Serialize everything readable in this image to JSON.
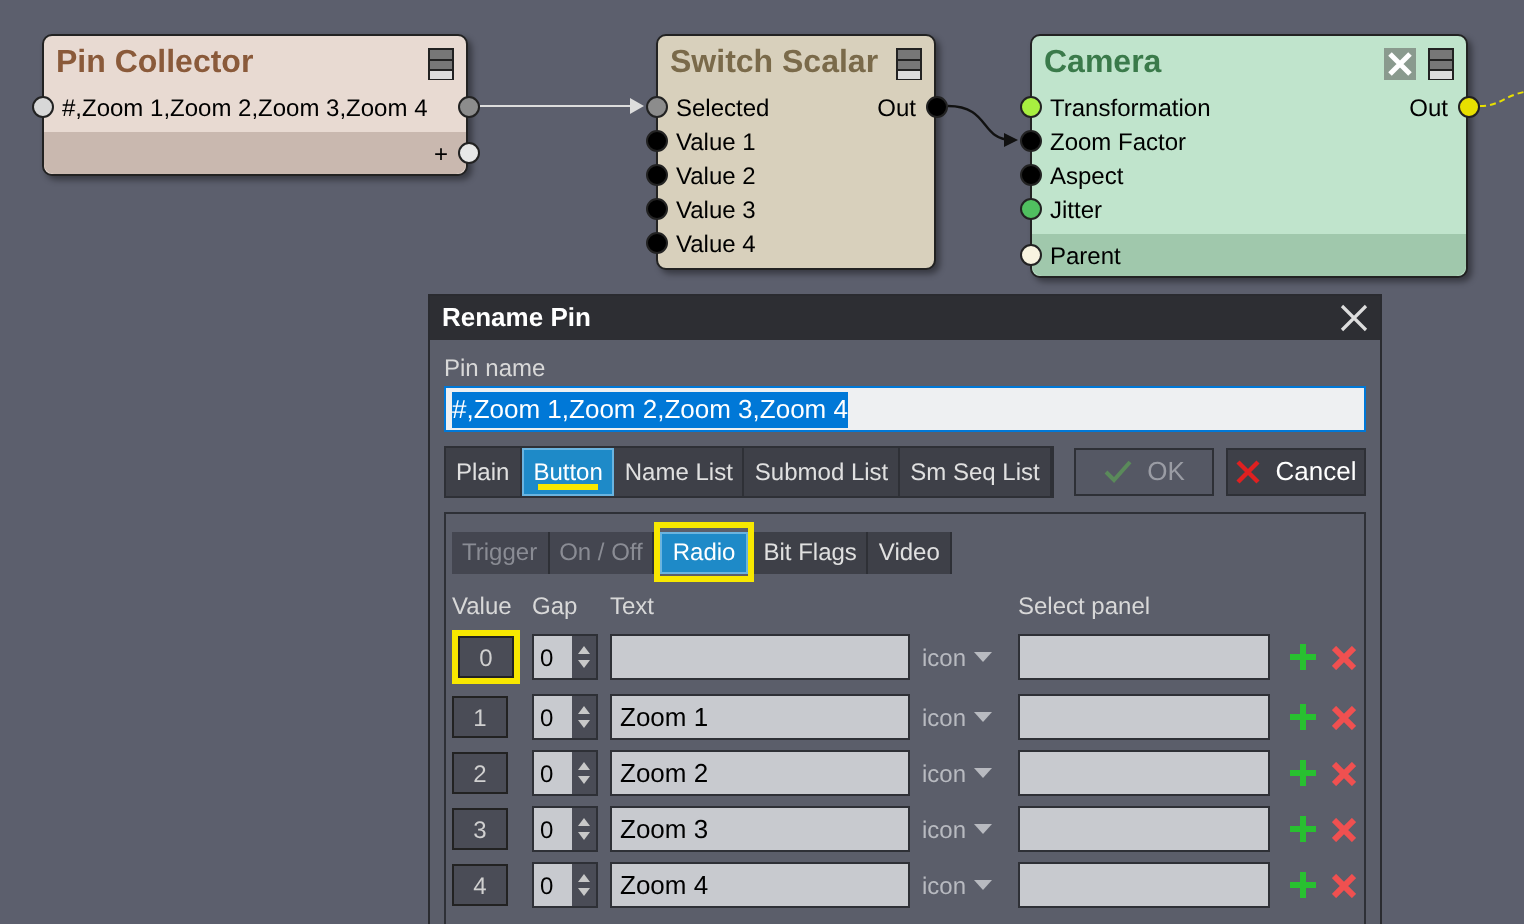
{
  "nodes": [
    {
      "title": "Pin Collector",
      "color": "#e8dad2",
      "closable": false,
      "rows": [
        {
          "in": {
            "label": "#,Zoom 1,Zoom 2,Zoom 3,Zoom 4",
            "color": "#d8d8d8"
          },
          "out": {
            "color": "#8c8c8c"
          }
        }
      ],
      "footer_rows": [
        {
          "out": {
            "label": "+",
            "color": "#e8e8e8"
          }
        }
      ]
    },
    {
      "title": "Switch Scalar",
      "color": "#d8d0bc",
      "closable": false,
      "rows": [
        {
          "in": {
            "label": "Selected",
            "color": "#8c8c8c"
          },
          "out": {
            "label": "Out",
            "color": "#000000"
          }
        },
        {
          "in": {
            "label": "Value 1",
            "color": "#000000"
          }
        },
        {
          "in": {
            "label": "Value 2",
            "color": "#000000"
          }
        },
        {
          "in": {
            "label": "Value 3",
            "color": "#000000"
          }
        },
        {
          "in": {
            "label": "Value 4",
            "color": "#000000"
          }
        }
      ]
    },
    {
      "title": "Camera",
      "color": "#c0e4cc",
      "closable": true,
      "rows": [
        {
          "in": {
            "label": "Transformation",
            "color": "#a8f040"
          },
          "out": {
            "label": "Out",
            "color": "#e8e000"
          }
        },
        {
          "in": {
            "label": "Zoom Factor",
            "color": "#000000"
          }
        },
        {
          "in": {
            "label": "Aspect",
            "color": "#000000"
          }
        },
        {
          "in": {
            "label": "Jitter",
            "color": "#50c060"
          }
        }
      ],
      "footer_rows": [
        {
          "in": {
            "label": "Parent",
            "color": "#f8f4e0"
          }
        }
      ]
    }
  ],
  "dialog": {
    "title": "Rename Pin",
    "field_label": "Pin name",
    "field_value": "#,Zoom 1,Zoom 2,Zoom 3,Zoom 4",
    "tabs": [
      {
        "label": "Plain",
        "selected": false,
        "underlined": false
      },
      {
        "label": "Button",
        "selected": true,
        "underlined": true
      },
      {
        "label": "Name List",
        "selected": false,
        "underlined": false
      },
      {
        "label": "Submod List",
        "selected": false,
        "underlined": false
      },
      {
        "label": "Sm Seq List",
        "selected": false,
        "underlined": false
      }
    ],
    "ok": {
      "label": "OK",
      "disabled": true
    },
    "cancel": {
      "label": "Cancel",
      "disabled": false
    },
    "subtabs": [
      {
        "label": "Trigger",
        "selected": false,
        "disabled": true,
        "boxed": false
      },
      {
        "label": "On / Off",
        "selected": false,
        "disabled": true,
        "boxed": false
      },
      {
        "label": "Radio",
        "selected": true,
        "disabled": false,
        "boxed": true
      },
      {
        "label": "Bit Flags",
        "selected": false,
        "disabled": false,
        "boxed": false
      },
      {
        "label": "Video",
        "selected": false,
        "disabled": false,
        "boxed": false
      }
    ],
    "columns": [
      "Value",
      "Gap",
      "Text",
      "Select panel"
    ],
    "value_column_highlighted": true,
    "rows": [
      {
        "value": "0",
        "gap": "0",
        "icon": "icon"
      },
      {
        "value": "1",
        "gap": "0",
        "text": "Zoom 1",
        "icon": "icon"
      },
      {
        "value": "2",
        "gap": "0",
        "text": "Zoom 2",
        "icon": "icon"
      },
      {
        "value": "3",
        "gap": "0",
        "text": "Zoom 3",
        "icon": "icon"
      },
      {
        "value": "4",
        "gap": "0",
        "text": "Zoom 4",
        "icon": "icon"
      }
    ]
  }
}
